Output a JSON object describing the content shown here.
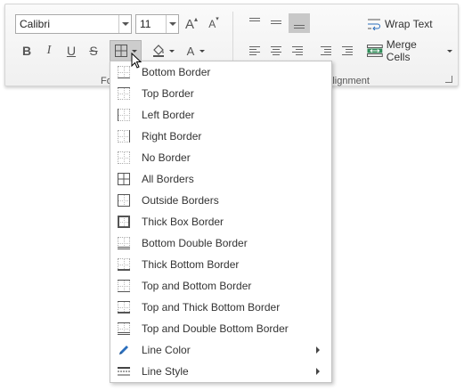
{
  "font": {
    "name": "Calibri",
    "size": "11",
    "group_label": "Fo"
  },
  "alignment": {
    "group_label": "Alignment",
    "wrap_text_label": "Wrap Text",
    "merge_cells_label": "Merge Cells"
  },
  "format_buttons": {
    "bold": "B",
    "italic": "I",
    "underline": "U",
    "strikethrough": "S",
    "font_color": "A"
  },
  "grow_font": "A",
  "shrink_font": "A",
  "border_menu": {
    "items": [
      {
        "label": "Bottom Border",
        "icon": "bottom-border-icon"
      },
      {
        "label": "Top Border",
        "icon": "top-border-icon"
      },
      {
        "label": "Left Border",
        "icon": "left-border-icon"
      },
      {
        "label": "Right Border",
        "icon": "right-border-icon"
      },
      {
        "label": "No Border",
        "icon": "no-border-icon"
      },
      {
        "label": "All Borders",
        "icon": "all-borders-icon"
      },
      {
        "label": "Outside Borders",
        "icon": "outside-borders-icon"
      },
      {
        "label": "Thick Box Border",
        "icon": "thick-box-border-icon"
      },
      {
        "label": "Bottom Double Border",
        "icon": "bottom-double-border-icon"
      },
      {
        "label": "Thick Bottom Border",
        "icon": "thick-bottom-border-icon"
      },
      {
        "label": "Top and Bottom Border",
        "icon": "top-and-bottom-border-icon"
      },
      {
        "label": "Top and Thick Bottom Border",
        "icon": "top-and-thick-bottom-border-icon"
      },
      {
        "label": "Top and Double Bottom Border",
        "icon": "top-and-double-bottom-border-icon"
      },
      {
        "label": "Line Color",
        "icon": "pencil-icon",
        "submenu": true
      },
      {
        "label": "Line Style",
        "icon": "line-style-icon",
        "submenu": true
      }
    ]
  },
  "colors": {
    "ribbon_bg": "#f0f0f0",
    "pressed": "#c8c8c8",
    "accent_blue": "#2a6ebd",
    "merge_green": "#2e8b57"
  }
}
